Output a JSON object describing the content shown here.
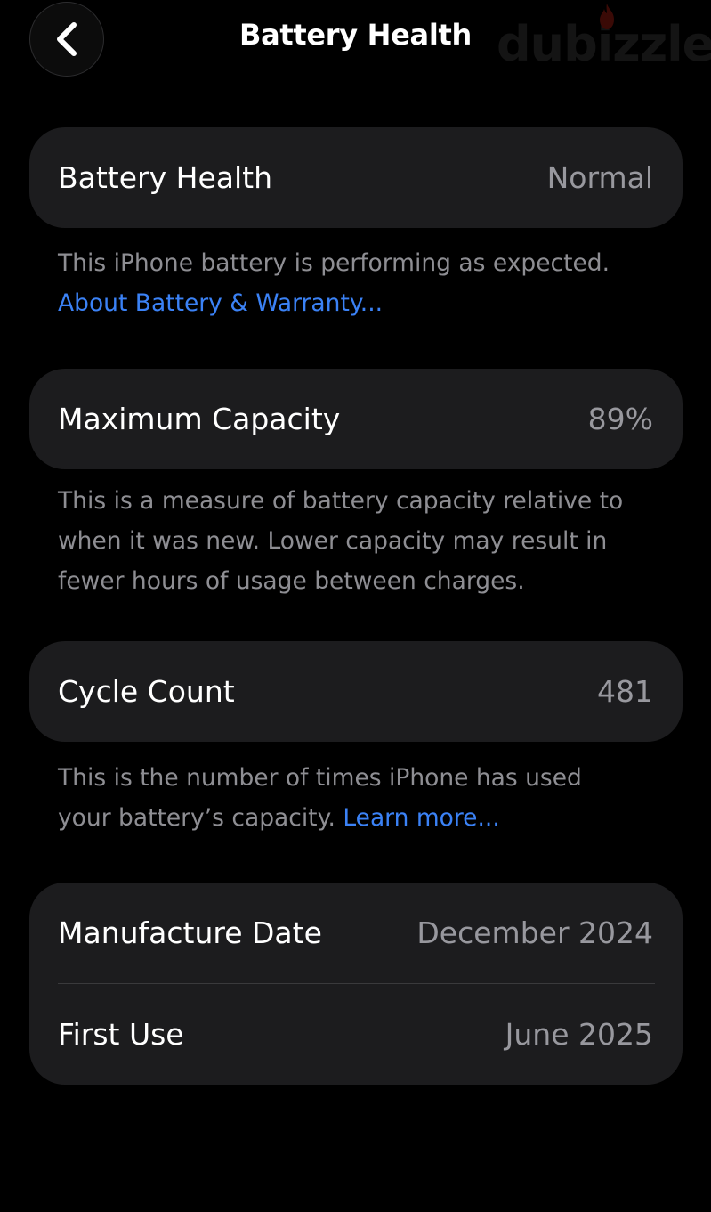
{
  "nav": {
    "title": "Battery Health",
    "back_icon": "chevron-left-icon"
  },
  "watermark": {
    "text": "dubizzle"
  },
  "battery_health": {
    "label": "Battery Health",
    "value": "Normal",
    "note": "This iPhone battery is performing as expected.",
    "link": "About Battery & Warranty..."
  },
  "max_capacity": {
    "label": "Maximum Capacity",
    "value": "89%",
    "note": "This is a measure of battery capacity relative to when it was new. Lower capacity may result in fewer hours of usage between charges."
  },
  "cycle_count": {
    "label": "Cycle Count",
    "value": "481",
    "note": "This is the number of times iPhone has used your battery’s capacity.",
    "link": "Learn more..."
  },
  "dates": {
    "manufacture_label": "Manufacture Date",
    "manufacture_value": "December 2024",
    "first_use_label": "First Use",
    "first_use_value": "June 2025"
  },
  "colors": {
    "background": "#000000",
    "card": "#1c1c1e",
    "secondary_text": "#8e8e93",
    "link": "#3b82f6"
  }
}
